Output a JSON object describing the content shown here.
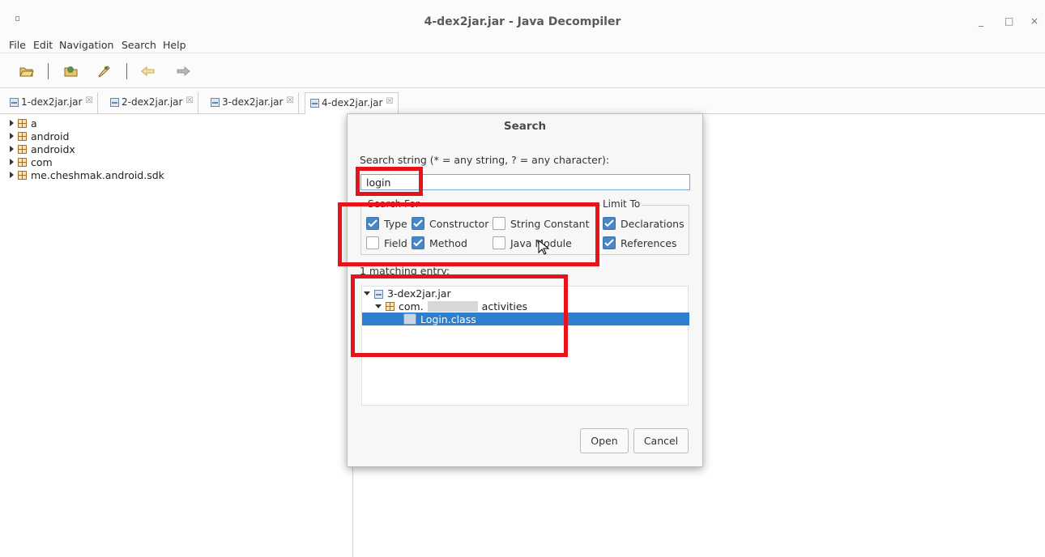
{
  "window": {
    "title": "4-dex2jar.jar - Java Decompiler"
  },
  "window_controls": {
    "minimize": "_",
    "maximize": "□",
    "close": "×"
  },
  "menu": [
    "File",
    "Edit",
    "Navigation",
    "Search",
    "Help"
  ],
  "toolbar": {
    "icons": [
      "open-file-icon",
      "open-type-icon",
      "search-icon",
      "back-icon",
      "forward-icon"
    ]
  },
  "tabs": [
    {
      "label": "1-dex2jar.jar",
      "close": "☒",
      "active": false
    },
    {
      "label": "2-dex2jar.jar",
      "close": "☒",
      "active": false
    },
    {
      "label": "3-dex2jar.jar",
      "close": "☒",
      "active": false
    },
    {
      "label": "4-dex2jar.jar",
      "close": "☒",
      "active": true
    }
  ],
  "tree": [
    "a",
    "android",
    "androidx",
    "com",
    "me.cheshmak.android.sdk"
  ],
  "search_dialog": {
    "title": "Search",
    "search_label": "Search string (* = any string, ? = any character):",
    "search_value": "login",
    "search_for_legend": "Search For",
    "limit_to_legend": "Limit To",
    "search_for": {
      "type": {
        "label": "Type",
        "checked": true
      },
      "constructor": {
        "label": "Constructor",
        "checked": true
      },
      "string_constant": {
        "label": "String Constant",
        "checked": false
      },
      "field": {
        "label": "Field",
        "checked": false
      },
      "method": {
        "label": "Method",
        "checked": true
      },
      "java_module": {
        "label": "Java Module",
        "checked": false
      }
    },
    "limit_to": {
      "declarations": {
        "label": "Declarations",
        "checked": true
      },
      "references": {
        "label": "References",
        "checked": true
      }
    },
    "match_count_label": "1 matching entry:",
    "results": {
      "jar": "3-dex2jar.jar",
      "package_prefix": "com.",
      "package_suffix": "activities",
      "class_name": "Login.class"
    },
    "open_button": "Open",
    "cancel_button": "Cancel"
  },
  "colors": {
    "highlight_box": "#e8131a",
    "selection": "#2f7fcf",
    "checkbox_checked": "#4a86c5"
  }
}
